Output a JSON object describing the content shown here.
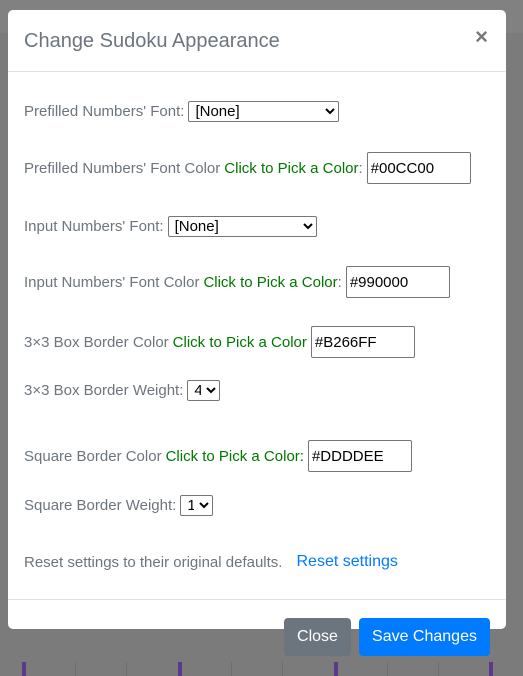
{
  "modal": {
    "title": "Change Sudoku Appearance",
    "close_icon": "×"
  },
  "form": {
    "prefilled_font_label": "Prefilled Numbers' Font:",
    "prefilled_font_value": "[None]",
    "prefilled_color_label": "Prefilled Numbers' Font Color",
    "prefilled_color_pick": "Click to Pick a Color",
    "prefilled_color_sep": " :",
    "prefilled_color_value": "#00CC00",
    "input_font_label": "Input Numbers' Font:",
    "input_font_value": "[None]",
    "input_color_label": "Input Numbers' Font Color",
    "input_color_pick": "Click to Pick a Color",
    "input_color_sep": " :",
    "input_color_value": "#990000",
    "box_color_label": "3×3 Box Border Color",
    "box_color_pick": "Click to Pick a Color",
    "box_color_value": "#B266FF",
    "box_weight_label": "3×3 Box Border Weight:",
    "box_weight_value": "4",
    "square_color_label": "Square Border Color",
    "square_color_pick": "Click to Pick a Color:",
    "square_color_value": "#DDDDEE",
    "square_weight_label": "Square Border Weight:",
    "square_weight_value": "1",
    "reset_text": "Reset settings to their original defaults.",
    "reset_link": "Reset settings"
  },
  "footer": {
    "close_label": "Close",
    "save_label": "Save Changes"
  },
  "colors": {
    "primary": "#007bff",
    "secondary": "#6c757d",
    "pick_link": "#007700"
  }
}
